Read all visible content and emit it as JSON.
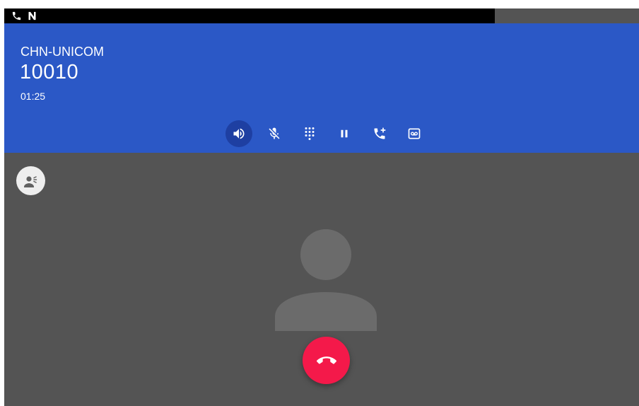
{
  "status_bar": {
    "icons": [
      "phone-icon",
      "nfc-icon"
    ]
  },
  "call": {
    "carrier": "CHN-UNICOM",
    "number": "10010",
    "duration": "01:25"
  },
  "controls": [
    {
      "name": "speaker",
      "icon": "speaker-icon",
      "active": true
    },
    {
      "name": "mute",
      "icon": "mic-off-icon",
      "active": false
    },
    {
      "name": "dialpad",
      "icon": "dialpad-icon",
      "active": false
    },
    {
      "name": "hold",
      "icon": "pause-icon",
      "active": false
    },
    {
      "name": "add-call",
      "icon": "add-call-icon",
      "active": false
    },
    {
      "name": "voicemail",
      "icon": "voicemail-icon",
      "active": false
    }
  ],
  "colors": {
    "header": "#2b58c6",
    "active_control": "#1e3fa2",
    "background": "#545454",
    "end_call": "#f4194a"
  }
}
